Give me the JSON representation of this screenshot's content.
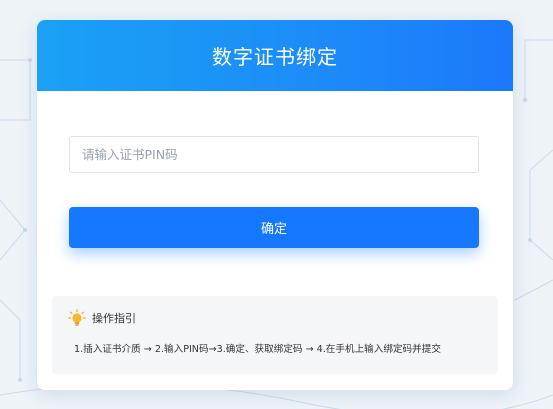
{
  "header": {
    "title": "数字证书绑定"
  },
  "form": {
    "pin_placeholder": "请输入证书PIN码",
    "pin_value": "",
    "confirm_label": "确定"
  },
  "guide": {
    "icon": "lightbulb-icon",
    "title": "操作指引",
    "steps": "1.插入证书介质 → 2.输入PIN码→3.确定、获取绑定码 → 4.在手机上输入绑定码并提交"
  },
  "colors": {
    "header_gradient_start": "#1aa1f5",
    "header_gradient_end": "#1b79fb",
    "button": "#1677ff",
    "bulb": "#f5a623"
  }
}
